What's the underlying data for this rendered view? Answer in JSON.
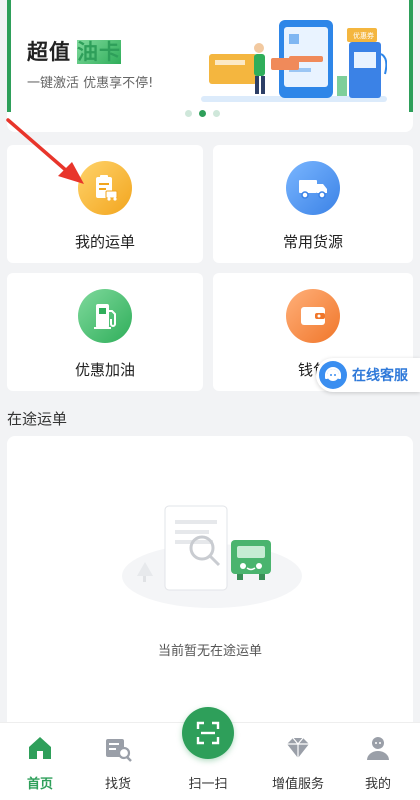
{
  "banner": {
    "title_main": "超值",
    "title_accent": "油卡",
    "subtitle": "一键激活 优惠享不停!",
    "art_text": "优惠券"
  },
  "grid": [
    {
      "label": "我的运单",
      "icon": "clipboard-truck-icon",
      "color": "#f2a51e"
    },
    {
      "label": "常用货源",
      "icon": "truck-icon",
      "color": "#3b82e6"
    },
    {
      "label": "优惠加油",
      "icon": "fuel-pump-icon",
      "color": "#2fae5a"
    },
    {
      "label": "钱包",
      "icon": "wallet-icon",
      "color": "#f0762a"
    }
  ],
  "floating_service": {
    "label": "在线客服",
    "icon": "customer-service-icon"
  },
  "section": {
    "title": "在途运单",
    "empty_text": "当前暂无在途运单"
  },
  "tabbar": [
    {
      "label": "首页",
      "icon": "home-icon",
      "active": true
    },
    {
      "label": "找货",
      "icon": "find-goods-icon",
      "active": false
    },
    {
      "label": "扫一扫",
      "icon": "scan-icon",
      "active": false
    },
    {
      "label": "增值服务",
      "icon": "diamond-icon",
      "active": false
    },
    {
      "label": "我的",
      "icon": "user-icon",
      "active": false
    }
  ],
  "colors": {
    "brand_green": "#2e9f5a",
    "service_blue": "#2f79d9"
  }
}
